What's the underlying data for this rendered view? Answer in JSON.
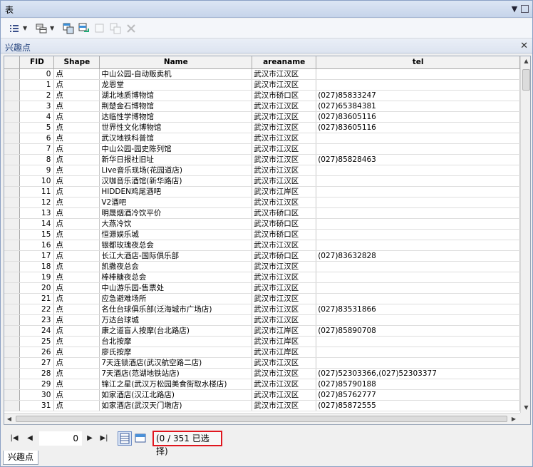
{
  "window": {
    "title": "表"
  },
  "tab": {
    "name": "兴趣点"
  },
  "columns": [
    "FID",
    "Shape",
    "Name",
    "areaname",
    "tel"
  ],
  "rows": [
    [
      "0",
      "点",
      "中山公园-自动贩卖机",
      "武汉市江汉区",
      ""
    ],
    [
      "1",
      "点",
      "龙恩堂",
      "武汉市江汉区",
      ""
    ],
    [
      "2",
      "点",
      "湖北地质博物馆",
      "武汉市硚口区",
      "(027)85833247"
    ],
    [
      "3",
      "点",
      "荆楚金石博物馆",
      "武汉市江汉区",
      "(027)65384381"
    ],
    [
      "4",
      "点",
      "达临性学博物馆",
      "武汉市江汉区",
      "(027)83605116"
    ],
    [
      "5",
      "点",
      "世界性文化博物馆",
      "武汉市江汉区",
      "(027)83605116"
    ],
    [
      "6",
      "点",
      "武汉地铁科普馆",
      "武汉市江汉区",
      ""
    ],
    [
      "7",
      "点",
      "中山公园-园史陈列馆",
      "武汉市江汉区",
      ""
    ],
    [
      "8",
      "点",
      "新华日报社旧址",
      "武汉市江汉区",
      "(027)85828463"
    ],
    [
      "9",
      "点",
      "Live音乐现场(花园道店)",
      "武汉市江汉区",
      ""
    ],
    [
      "10",
      "点",
      "汉咖音乐酒馆(新华路店)",
      "武汉市江汉区",
      ""
    ],
    [
      "11",
      "点",
      "HIDDEN鸡尾酒吧",
      "武汉市江岸区",
      ""
    ],
    [
      "12",
      "点",
      "V2酒吧",
      "武汉市江汉区",
      ""
    ],
    [
      "13",
      "点",
      "明晟烟酒冷饮平价",
      "武汉市硚口区",
      ""
    ],
    [
      "14",
      "点",
      "大燕冷饮",
      "武汉市硚口区",
      ""
    ],
    [
      "15",
      "点",
      "恒源娱乐城",
      "武汉市硚口区",
      ""
    ],
    [
      "16",
      "点",
      "银都玫瑰夜总会",
      "武汉市江汉区",
      ""
    ],
    [
      "17",
      "点",
      "长江大酒店-国际俱乐部",
      "武汉市硚口区",
      "(027)83632828"
    ],
    [
      "18",
      "点",
      "凯撒夜总会",
      "武汉市江汉区",
      ""
    ],
    [
      "19",
      "点",
      "棒棒糖夜总会",
      "武汉市江汉区",
      ""
    ],
    [
      "20",
      "点",
      "中山游乐园-售票处",
      "武汉市江汉区",
      ""
    ],
    [
      "21",
      "点",
      "应急避难场所",
      "武汉市江汉区",
      ""
    ],
    [
      "22",
      "点",
      "名仕台球俱乐部(泛海城市广场店)",
      "武汉市江汉区",
      "(027)83531866"
    ],
    [
      "23",
      "点",
      "万达台球城",
      "武汉市江汉区",
      ""
    ],
    [
      "24",
      "点",
      "康之道盲人按摩(台北路店)",
      "武汉市江岸区",
      "(027)85890708"
    ],
    [
      "25",
      "点",
      "台北按摩",
      "武汉市江岸区",
      ""
    ],
    [
      "26",
      "点",
      "廖氏按摩",
      "武汉市江岸区",
      ""
    ],
    [
      "27",
      "点",
      "7天连锁酒店(武汉航空路二店)",
      "武汉市江汉区",
      ""
    ],
    [
      "28",
      "点",
      "7天酒店(范湖地铁站店)",
      "武汉市江汉区",
      "(027)52303366,(027)52303377"
    ],
    [
      "29",
      "点",
      "锦江之星(武汉万松园美食街取水楼店)",
      "武汉市江汉区",
      "(027)85790188"
    ],
    [
      "30",
      "点",
      "如家酒店(汉江北路店)",
      "武汉市江汉区",
      "(027)85762777"
    ],
    [
      "31",
      "点",
      "如家酒店(武汉天门墩店)",
      "武汉市江汉区",
      "(027)85872555"
    ]
  ],
  "navigation": {
    "current_record": "0",
    "selection_count": "(0 / 351 已选择)"
  },
  "bottom_tab": {
    "label": "兴趣点"
  }
}
